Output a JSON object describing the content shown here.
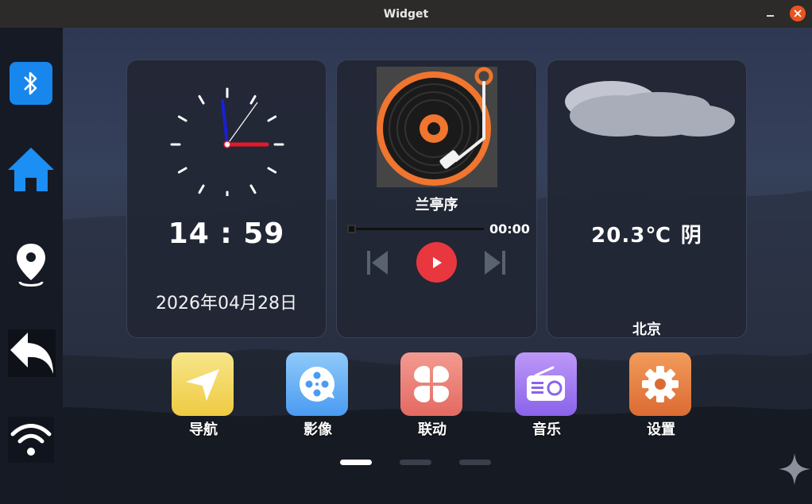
{
  "window": {
    "title": "Widget"
  },
  "clock": {
    "time": "14 : 59",
    "date": "2026年04月28日"
  },
  "music": {
    "song": "兰亭序",
    "elapsed": "00:00",
    "progress": 0
  },
  "weather": {
    "temperature": "20.3℃",
    "condition": "阴",
    "city": "北京"
  },
  "apps": [
    {
      "label": "导航"
    },
    {
      "label": "影像"
    },
    {
      "label": "联动"
    },
    {
      "label": "音乐"
    },
    {
      "label": "设置"
    }
  ],
  "sidebar": {
    "items": [
      "bluetooth-icon",
      "home-icon",
      "location-pin-icon",
      "back-arrow-icon",
      "wifi-icon"
    ]
  },
  "pager": {
    "pages": 3,
    "active": 1
  },
  "colors": {
    "accent_blue": "#1787ee",
    "play_red": "#e8373f",
    "close_orange": "#e95420",
    "nav_yellow": "#efcb42",
    "media_blue": "#4a9bf2",
    "link_red": "#e36a62",
    "music_purple": "#8a63ea",
    "settings_orange": "#dc6b33"
  }
}
